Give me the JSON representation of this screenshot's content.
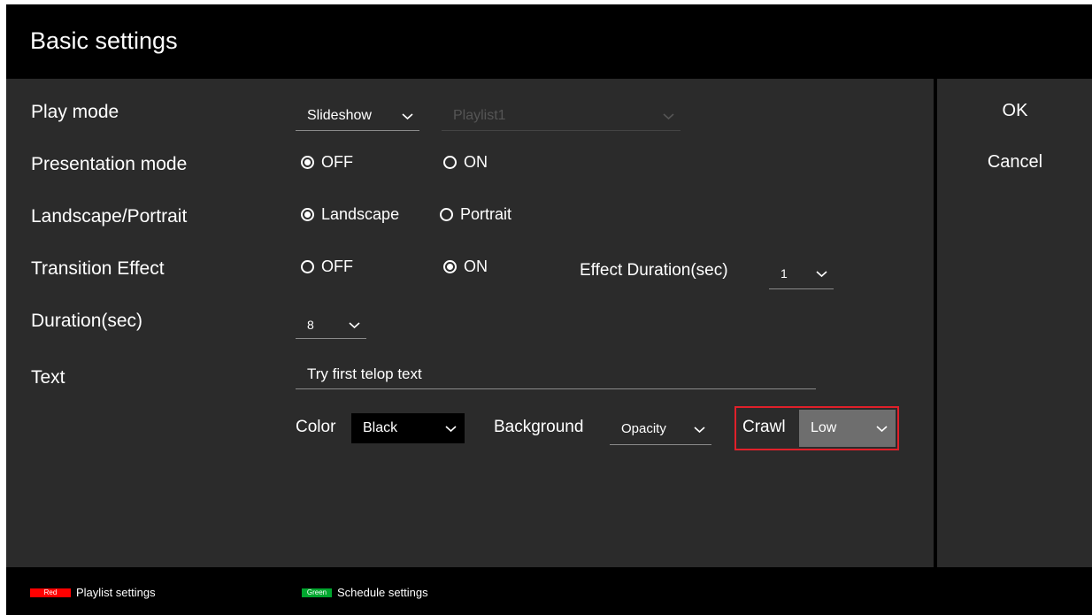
{
  "title": "Basic settings",
  "side_buttons": {
    "ok": "OK",
    "cancel": "Cancel"
  },
  "play_mode": {
    "label": "Play mode",
    "mode_value": "Slideshow",
    "playlist_value": "Playlist1"
  },
  "presentation_mode": {
    "label": "Presentation mode",
    "off": "OFF",
    "on": "ON",
    "selected": "off"
  },
  "orientation": {
    "label": "Landscape/Portrait",
    "landscape": "Landscape",
    "portrait": "Portrait",
    "selected": "landscape"
  },
  "transition_effect": {
    "label": "Transition Effect",
    "off": "OFF",
    "on": "ON",
    "selected": "on",
    "effect_duration_label": "Effect Duration(sec)",
    "effect_duration_value": "1"
  },
  "duration": {
    "label": "Duration(sec)",
    "value": "8"
  },
  "text": {
    "label": "Text",
    "value": "Try first telop text",
    "color_label": "Color",
    "color_value": "Black",
    "background_label": "Background",
    "background_value": "Opacity",
    "crawl_label": "Crawl",
    "crawl_value": "Low"
  },
  "footer": {
    "red_key": "Red",
    "red_label": "Playlist settings",
    "red_color": "#ff0000",
    "green_key": "Green",
    "green_label": "Schedule settings",
    "green_color": "#00a62e"
  },
  "colors": {
    "background": "#2b2b2b",
    "bars": "#000000",
    "highlight": "#e0202a"
  }
}
